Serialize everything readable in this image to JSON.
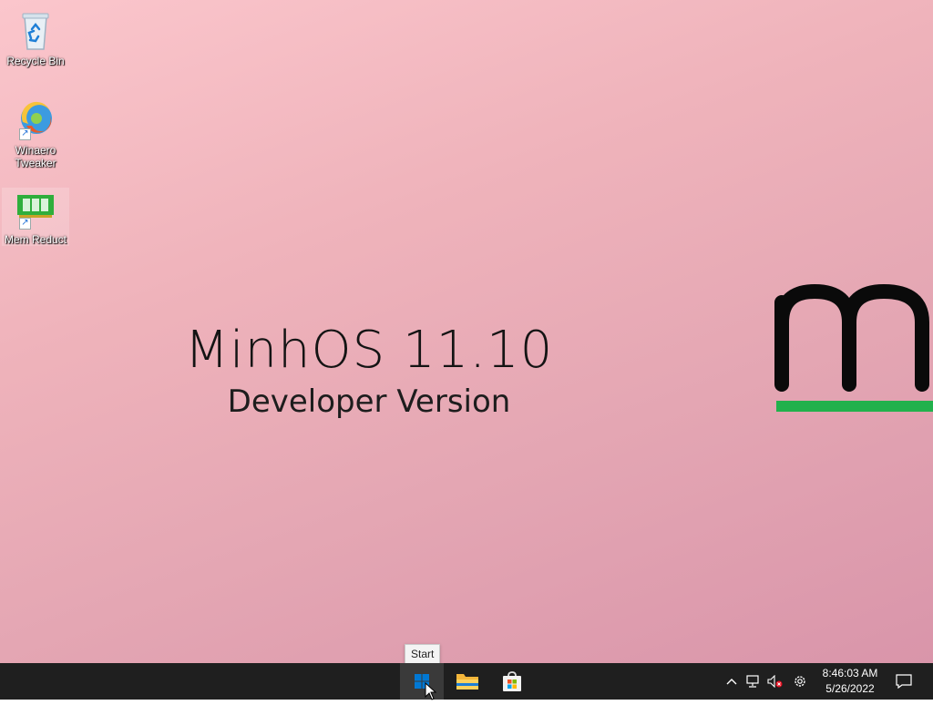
{
  "desktop": {
    "icons": [
      {
        "label": "Recycle Bin",
        "icon": "recycle-bin-icon"
      },
      {
        "label": "Winaero Tweaker",
        "icon": "winaero-tweaker-icon"
      },
      {
        "label": "Mem Reduct",
        "icon": "mem-reduct-icon"
      }
    ],
    "wallpaper": {
      "title": "MinhOS 11.10",
      "subtitle": "Developer Version",
      "logo_text": "m",
      "colors": {
        "background_start": "#fbc6cc",
        "background_end": "#d995aa",
        "logo": "#0a0a0a",
        "logo_accent": "#22b14c"
      }
    }
  },
  "tooltip": {
    "text": "Start"
  },
  "taskbar": {
    "buttons": [
      {
        "name": "Start",
        "icon": "windows-start-icon"
      },
      {
        "name": "File Explorer",
        "icon": "folder-icon"
      },
      {
        "name": "Microsoft Store",
        "icon": "store-bag-icon"
      }
    ],
    "tray": {
      "icons": [
        "chevron-up-icon",
        "network-icon",
        "volume-muted-icon",
        "gear-icon"
      ],
      "time": "8:46:03 AM",
      "date": "5/26/2022",
      "notification_icon": "notification-icon"
    },
    "colors": {
      "background": "#1f1f1f",
      "start_blue": "#0078d4"
    }
  }
}
